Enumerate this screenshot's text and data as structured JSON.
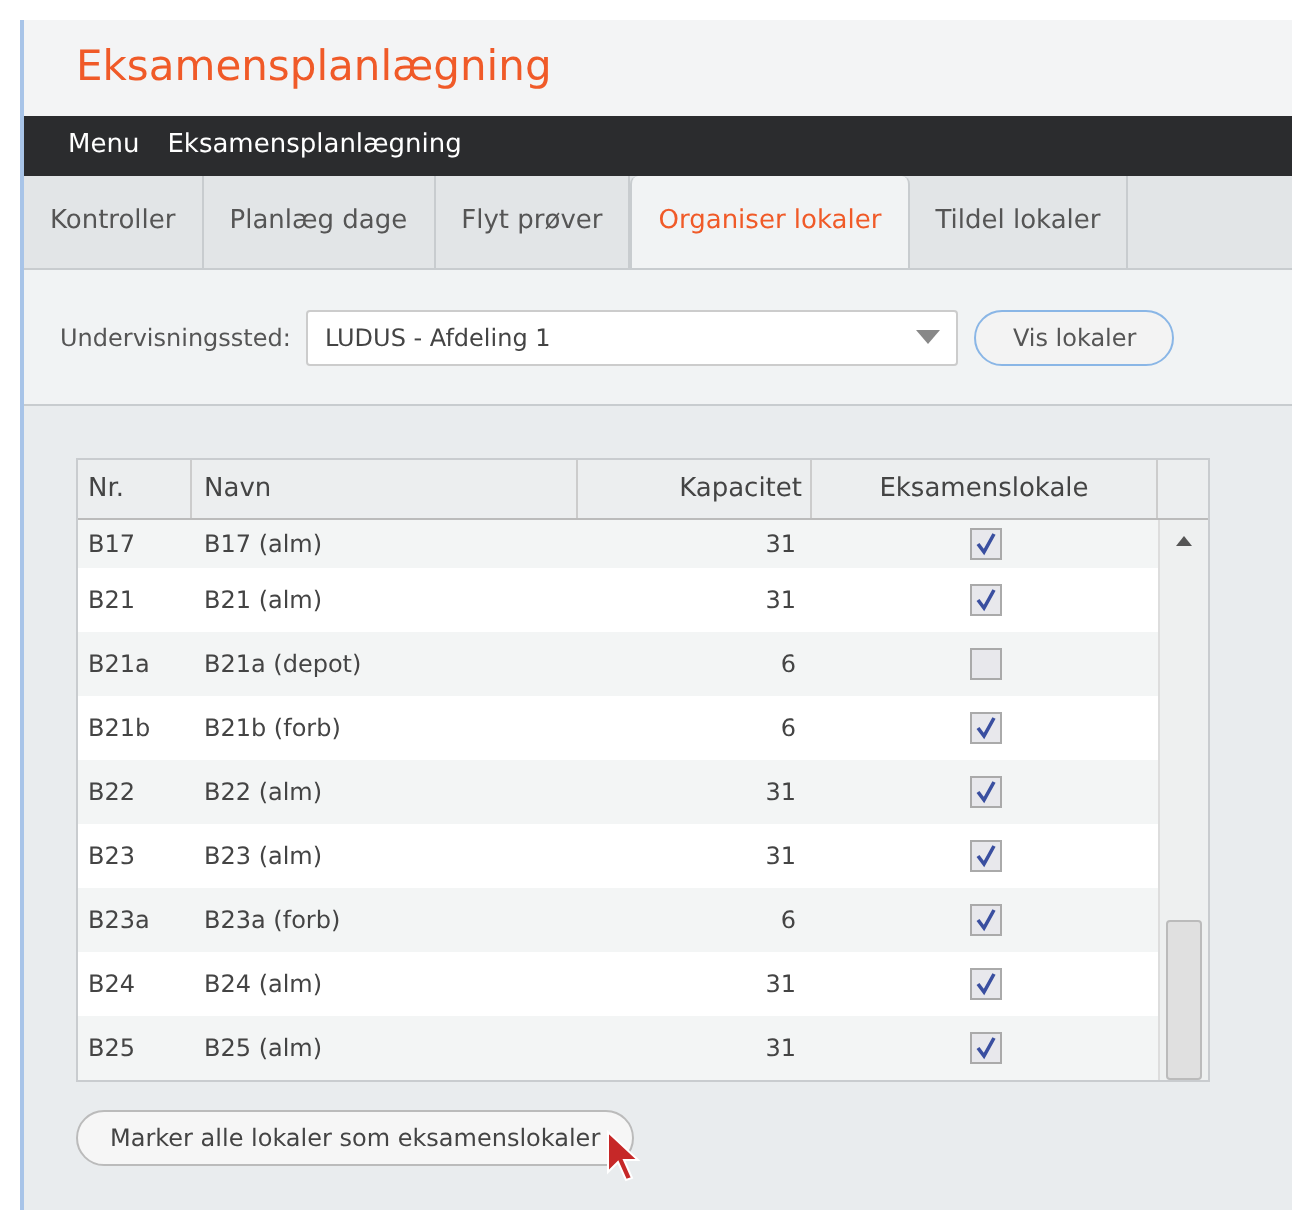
{
  "app_title": "Eksamensplanlægning",
  "menu_bar": [
    "Menu",
    "Eksamensplanlægning"
  ],
  "tabs": [
    {
      "label": "Kontroller",
      "selected": false
    },
    {
      "label": "Planlæg dage",
      "selected": false
    },
    {
      "label": "Flyt prøver",
      "selected": false
    },
    {
      "label": "Organiser lokaler",
      "selected": true
    },
    {
      "label": "Tildel lokaler",
      "selected": false
    }
  ],
  "filter": {
    "label": "Undervisningssted:",
    "value": "LUDUS - Afdeling 1",
    "button": "Vis lokaler"
  },
  "table": {
    "columns": [
      "Nr.",
      "Navn",
      "Kapacitet",
      "Eksamenslokale"
    ],
    "rows": [
      {
        "nr": "B17",
        "navn": "B17 (alm)",
        "kapacitet": "31",
        "checked": true
      },
      {
        "nr": "B21",
        "navn": "B21 (alm)",
        "kapacitet": "31",
        "checked": true
      },
      {
        "nr": "B21a",
        "navn": "B21a (depot)",
        "kapacitet": "6",
        "checked": false
      },
      {
        "nr": "B21b",
        "navn": "B21b (forb)",
        "kapacitet": "6",
        "checked": true
      },
      {
        "nr": "B22",
        "navn": "B22 (alm)",
        "kapacitet": "31",
        "checked": true
      },
      {
        "nr": "B23",
        "navn": "B23 (alm)",
        "kapacitet": "31",
        "checked": true
      },
      {
        "nr": "B23a",
        "navn": "B23a (forb)",
        "kapacitet": "6",
        "checked": true
      },
      {
        "nr": "B24",
        "navn": "B24 (alm)",
        "kapacitet": "31",
        "checked": true
      },
      {
        "nr": "B25",
        "navn": "B25 (alm)",
        "kapacitet": "31",
        "checked": true
      }
    ]
  },
  "mark_all_button": "Marker alle lokaler som eksamenslokaler"
}
